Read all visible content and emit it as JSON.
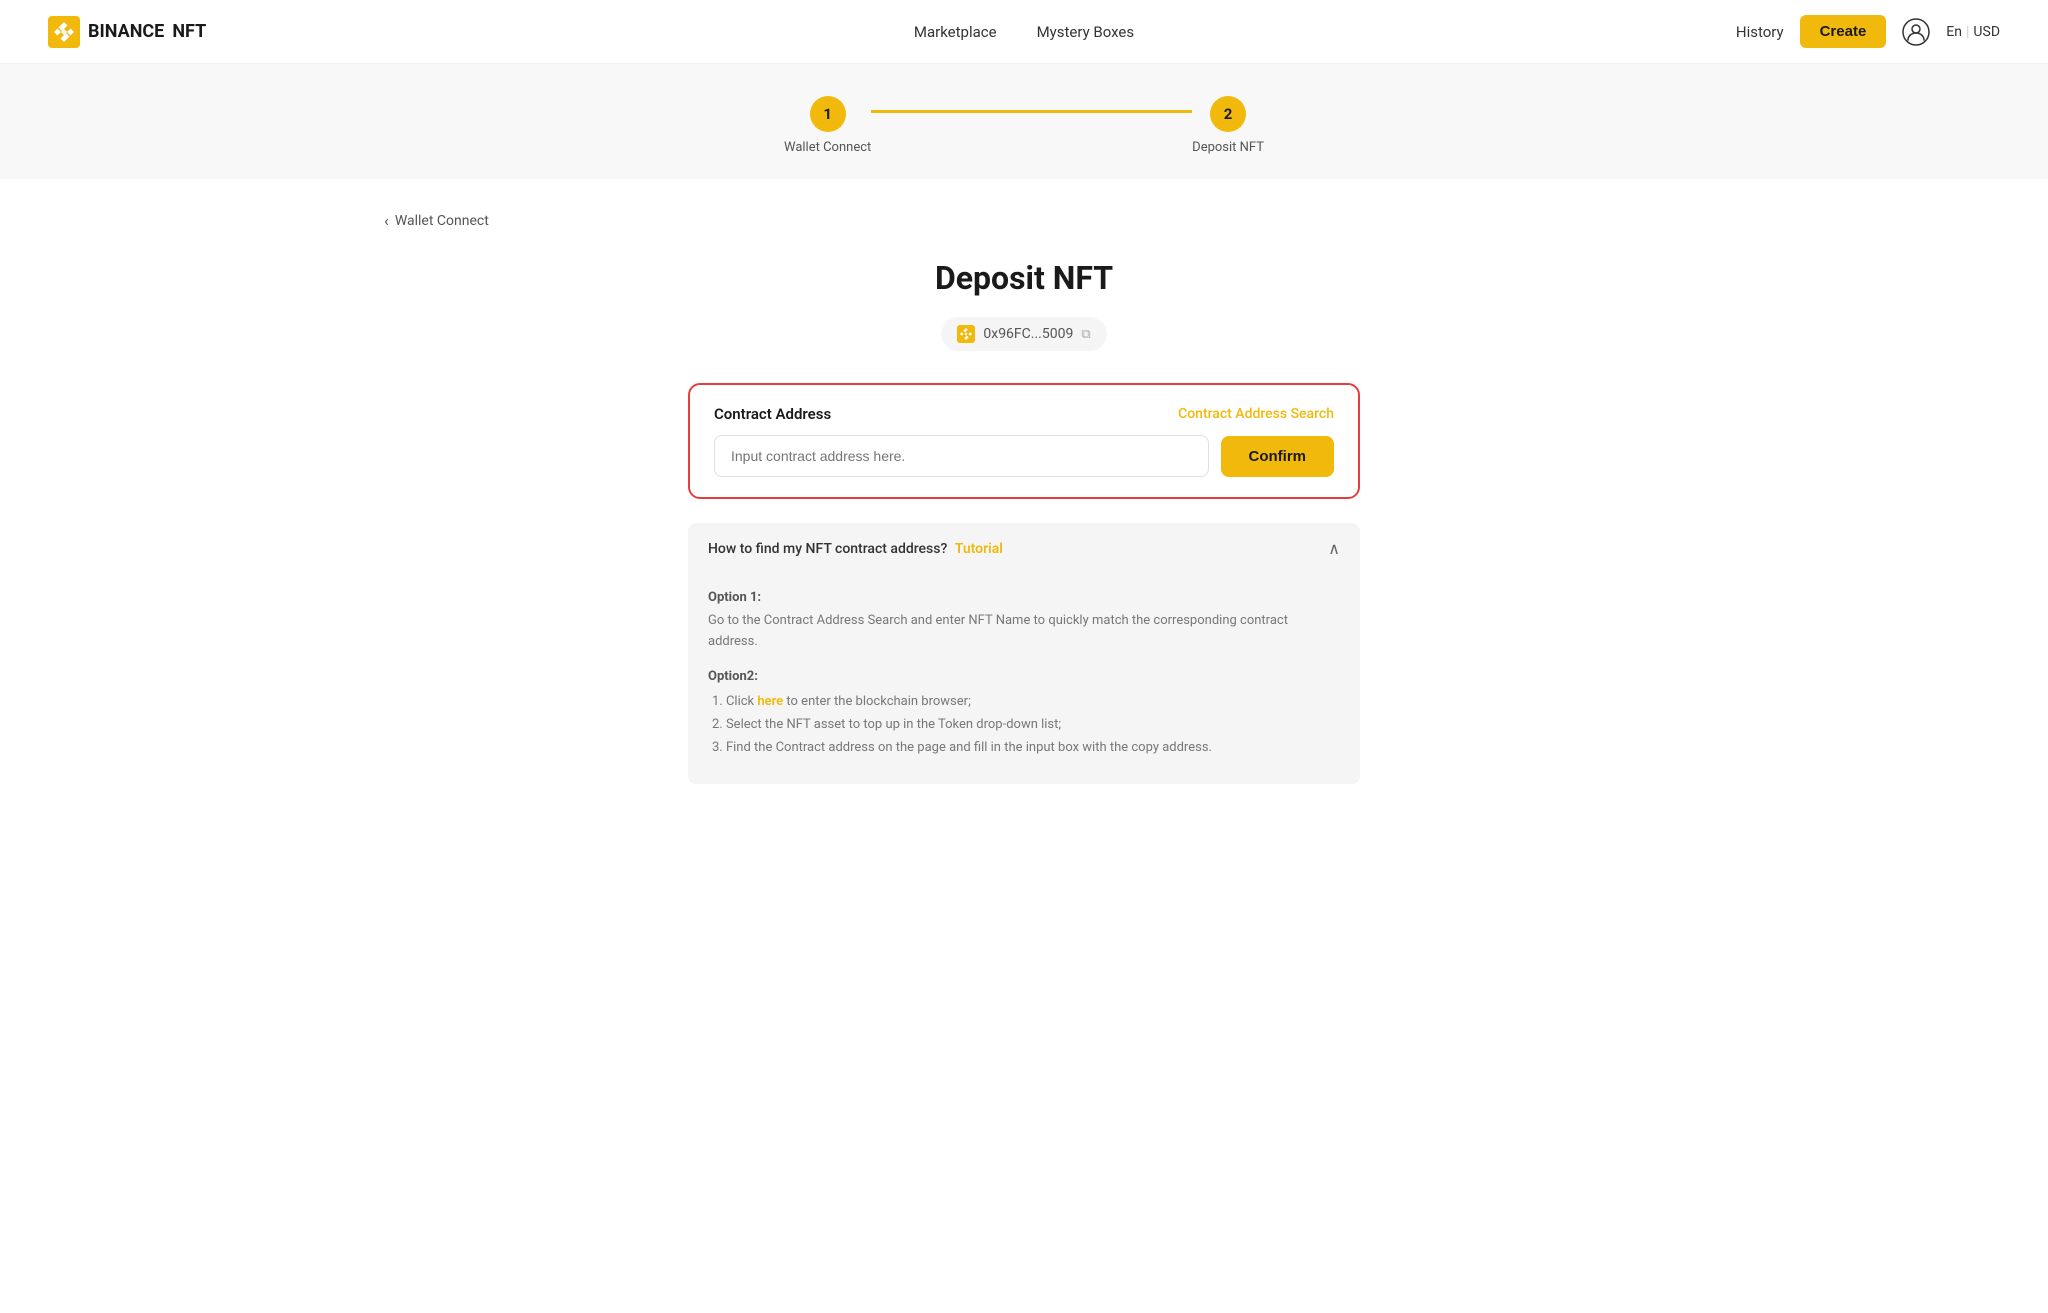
{
  "header": {
    "logo_text": "BINANCE",
    "logo_nft": "NFT",
    "nav": {
      "marketplace": "Marketplace",
      "mystery_boxes": "Mystery Boxes"
    },
    "history": "History",
    "create": "Create",
    "lang": "En",
    "currency": "USD"
  },
  "stepper": {
    "step1": {
      "number": "1",
      "label": "Wallet Connect"
    },
    "step2": {
      "number": "2",
      "label": "Deposit NFT"
    }
  },
  "back_link": "Wallet Connect",
  "page": {
    "title": "Deposit NFT",
    "wallet_address": "0x96FC...5009"
  },
  "contract": {
    "label": "Contract Address",
    "search_link": "Contract Address Search",
    "input_placeholder": "Input contract address here.",
    "confirm_button": "Confirm"
  },
  "faq": {
    "question": "How to find my NFT contract address?",
    "tutorial_label": "Tutorial",
    "chevron": "∧",
    "option1_title": "Option 1:",
    "option1_desc": "Go to the Contract Address Search and enter NFT Name to quickly match the corresponding contract address.",
    "option2_title": "Option2:",
    "option2_items": [
      "1. Click here to enter the blockchain browser;",
      "2. Select the NFT asset to top up in the Token drop-down list;",
      "3. Find the Contract address on the page and fill in the input box with the copy address."
    ],
    "here_link": "here"
  }
}
